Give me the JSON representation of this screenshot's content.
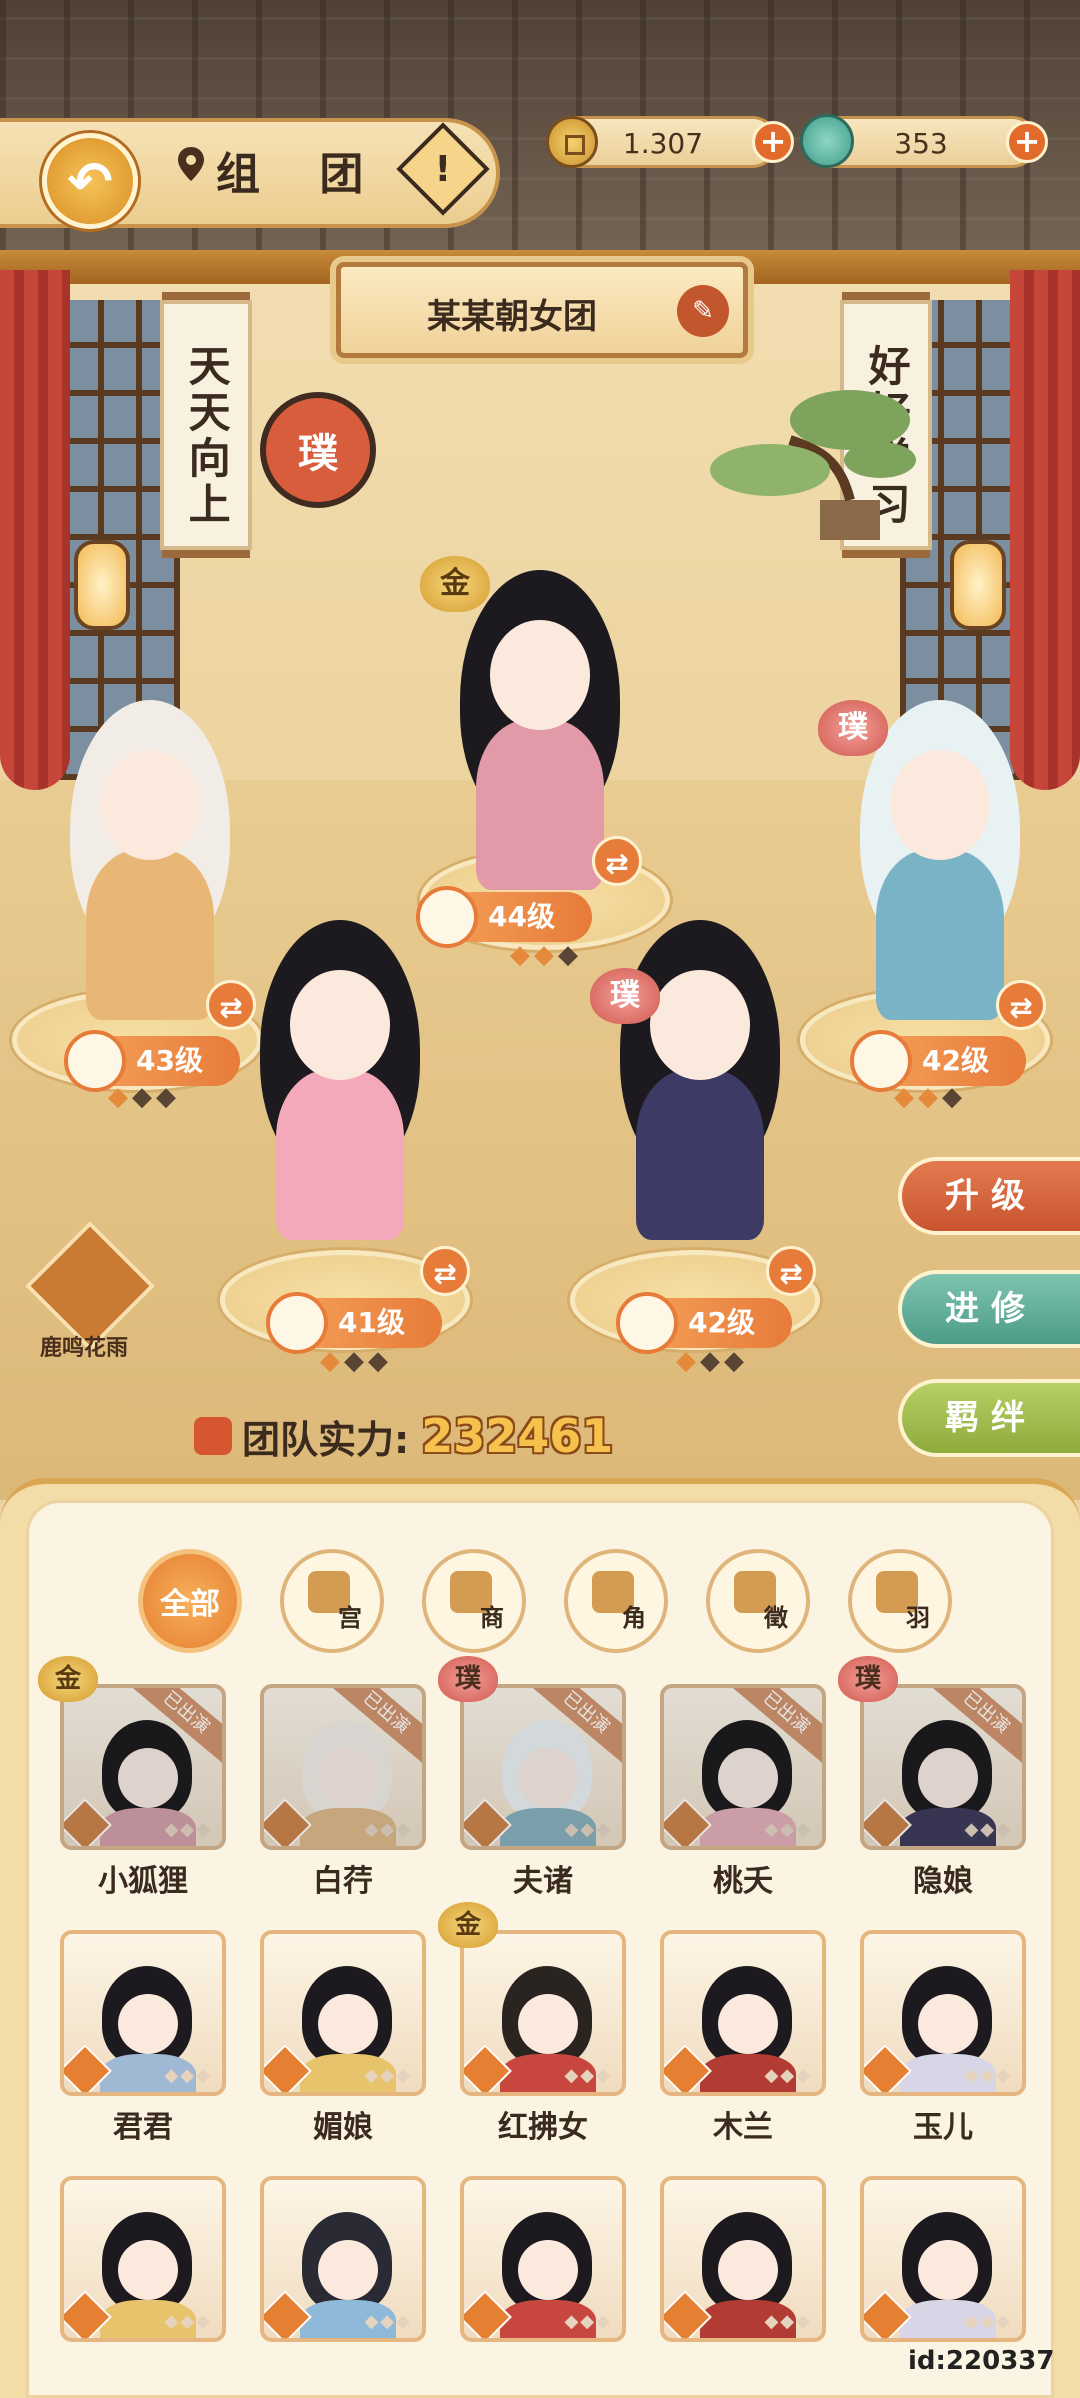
{
  "header": {
    "title": "组 团",
    "currency": {
      "coins": "1.307",
      "jade": "353"
    }
  },
  "team": {
    "name": "某某朝女团",
    "power_label": "团队实力:",
    "power_value": "232461"
  },
  "scene": {
    "scroll_left": "天天向上",
    "scroll_right": "好好学习",
    "seal_text": "璞"
  },
  "lineup": [
    {
      "level": "44级",
      "rank": "金",
      "stars_on": 2,
      "stars_total": 3,
      "hair": "#1c1a1f",
      "outfit": "#e39aa8"
    },
    {
      "level": "43级",
      "rank": "",
      "stars_on": 1,
      "stars_total": 3,
      "hair": "#f1ede6",
      "outfit": "#e9b775"
    },
    {
      "level": "42级",
      "rank": "璞",
      "stars_on": 2,
      "stars_total": 3,
      "hair": "#e8f2f3",
      "outfit": "#7ab3c5"
    },
    {
      "level": "41级",
      "rank": "",
      "stars_on": 1,
      "stars_total": 3,
      "hair": "#1c1a1f",
      "outfit": "#f3a9b9"
    },
    {
      "level": "42级",
      "rank": "璞",
      "stars_on": 1,
      "stars_total": 3,
      "hair": "#1c1a1f",
      "outfit": "#3d3a66"
    }
  ],
  "side_buttons": {
    "upgrade": "升级",
    "advance": "进修",
    "bond": "羁绊"
  },
  "event": {
    "label": "鹿鸣花雨"
  },
  "filters": [
    {
      "label": "全部",
      "active": true
    },
    {
      "label": "宫",
      "active": false
    },
    {
      "label": "商",
      "active": false
    },
    {
      "label": "角",
      "active": false
    },
    {
      "label": "徵",
      "active": false
    },
    {
      "label": "羽",
      "active": false
    }
  ],
  "deployed_tag": "已出演",
  "roster": [
    {
      "name": "小狐狸",
      "rank": "金",
      "deployed": true,
      "hair": "#1c1a1f",
      "outfit": "#e39aa8"
    },
    {
      "name": "白荇",
      "rank": "",
      "deployed": true,
      "hair": "#f1ede6",
      "outfit": "#e9b775"
    },
    {
      "name": "夫诸",
      "rank": "璞",
      "deployed": true,
      "hair": "#e8f2f3",
      "outfit": "#7ab3c5"
    },
    {
      "name": "桃夭",
      "rank": "",
      "deployed": true,
      "hair": "#1c1a1f",
      "outfit": "#f3a9b9"
    },
    {
      "name": "隐娘",
      "rank": "璞",
      "deployed": true,
      "hair": "#1c1a1f",
      "outfit": "#3d3a66"
    },
    {
      "name": "君君",
      "rank": "",
      "deployed": false,
      "hair": "#1c1a1f",
      "outfit": "#9fb8d4"
    },
    {
      "name": "媚娘",
      "rank": "",
      "deployed": false,
      "hair": "#1c1a1f",
      "outfit": "#e7c46b"
    },
    {
      "name": "红拂女",
      "rank": "金",
      "deployed": false,
      "hair": "#2a2420",
      "outfit": "#c7473e"
    },
    {
      "name": "木兰",
      "rank": "",
      "deployed": false,
      "hair": "#1c1a1f",
      "outfit": "#b23b33"
    },
    {
      "name": "玉儿",
      "rank": "",
      "deployed": false,
      "hair": "#1c1a1f",
      "outfit": "#d7d5e6"
    },
    {
      "name": "",
      "rank": "",
      "deployed": false,
      "hair": "#1c1a1f",
      "outfit": "#e7c46b"
    },
    {
      "name": "",
      "rank": "",
      "deployed": false,
      "hair": "#2a2a35",
      "outfit": "#8fb9d9"
    },
    {
      "name": "",
      "rank": "",
      "deployed": false,
      "hair": "#1c1a1f",
      "outfit": "#c7473e"
    },
    {
      "name": "",
      "rank": "",
      "deployed": false,
      "hair": "#1c1a1f",
      "outfit": "#b23b33"
    },
    {
      "name": "",
      "rank": "",
      "deployed": false,
      "hair": "#1c1a1f",
      "outfit": "#d7d5e6"
    }
  ],
  "footer": {
    "id_text": "id:220337"
  }
}
